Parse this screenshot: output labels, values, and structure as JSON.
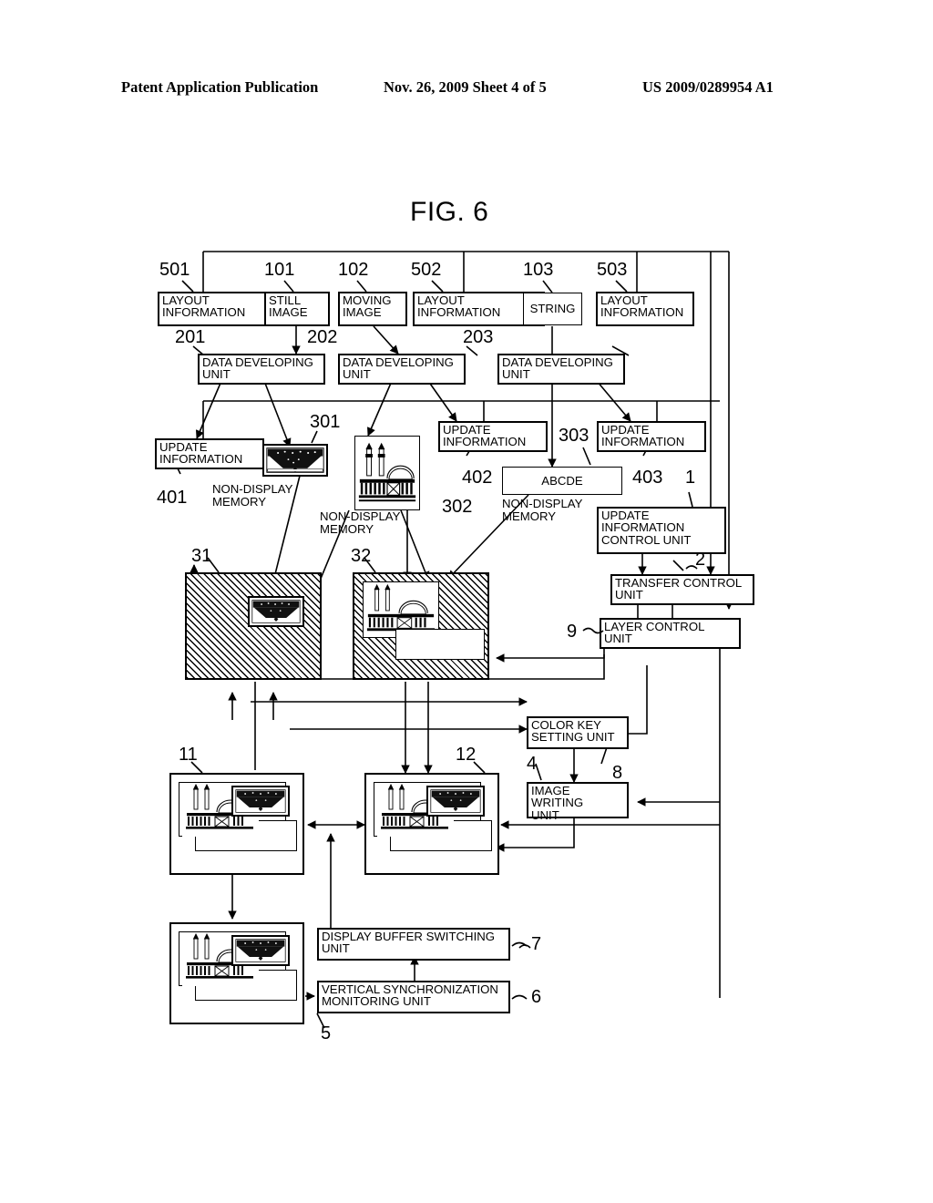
{
  "header": {
    "publication": "Patent Application Publication",
    "date_sheet": "Nov. 26, 2009  Sheet 4 of 5",
    "patent_number": "US 2009/0289954 A1"
  },
  "figure": {
    "title": "FIG. 6"
  },
  "colors": {
    "ink": "#000000",
    "paper": "#ffffff"
  },
  "blocks": {
    "layout_information_501": "LAYOUT\nINFORMATION",
    "still_image_101": "STILL\nIMAGE",
    "moving_image_102": "MOVING\nIMAGE",
    "layout_information_502": "LAYOUT\nINFORMATION",
    "string_103": "STRING",
    "layout_information_503": "LAYOUT\nINFORMATION",
    "data_developing_unit_201": "DATA DEVELOPING\nUNIT",
    "data_developing_unit_202": "DATA DEVELOPING\nUNIT",
    "data_developing_unit_203": "DATA DEVELOPING\nUNIT",
    "update_information_401": "UPDATE\nINFORMATION",
    "update_information_402": "UPDATE\nINFORMATION",
    "update_information_403": "UPDATE\nINFORMATION",
    "abcde_303": "ABCDE",
    "update_information_control_unit_1": "UPDATE\nINFORMATION\nCONTROL UNIT",
    "transfer_control_unit_2": "TRANSFER CONTROL\nUNIT",
    "layer_control_unit_9": "LAYER CONTROL\nUNIT",
    "color_key_setting_unit_8": "COLOR KEY\nSETTING UNIT",
    "image_writing_unit_4": "IMAGE WRITING\nUNIT",
    "display_buffer_switching_unit_7": "DISPLAY BUFFER SWITCHING\nUNIT",
    "vertical_synchronization_monitoring_unit_6": "VERTICAL SYNCHRONIZATION\nMONITORING UNIT"
  },
  "captions": {
    "non_display_memory_301": "NON-DISPLAY\nMEMORY",
    "non_display_memory_302": "NON-DISPLAY\nMEMORY",
    "non_display_memory_303": "NON-DISPLAY\nMEMORY"
  },
  "refs": {
    "r501": "501",
    "r101": "101",
    "r102": "102",
    "r502": "502",
    "r103": "103",
    "r503": "503",
    "r201": "201",
    "r202": "202",
    "r203": "203",
    "r301": "301",
    "r302": "302",
    "r303": "303",
    "r401": "401",
    "r402": "402",
    "r403": "403",
    "r1": "1",
    "r2": "2",
    "r9": "9",
    "r8": "8",
    "r4": "4",
    "r31": "31",
    "r32": "32",
    "r11": "11",
    "r12": "12",
    "r5": "5",
    "r6": "6",
    "r7": "7"
  }
}
